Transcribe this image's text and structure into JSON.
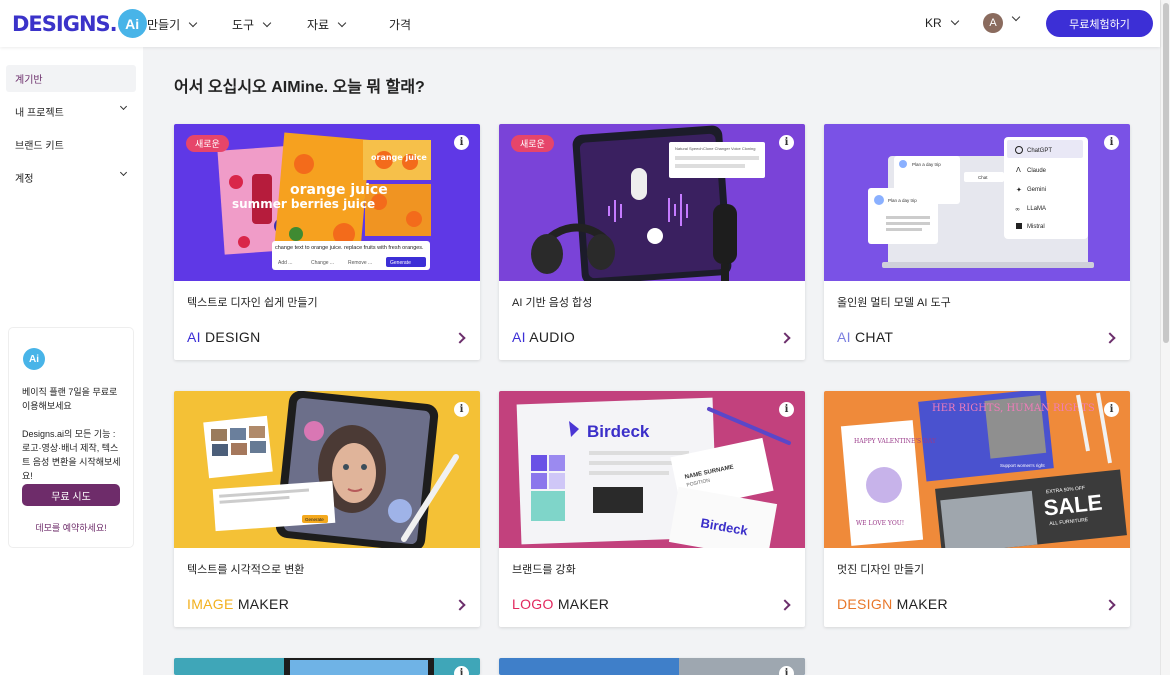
{
  "header": {
    "logo_text": "DESIGNS.",
    "logo_badge": "Ai",
    "nav": [
      {
        "label": "만들기"
      },
      {
        "label": "도구"
      },
      {
        "label": "자료"
      },
      {
        "label": "가격"
      }
    ],
    "language": "KR",
    "avatar_initial": "A",
    "cta_label": "무료체험하기"
  },
  "sidebar": {
    "items": [
      {
        "label": "계기반"
      },
      {
        "label": "내 프로젝트"
      },
      {
        "label": "브랜드 키트"
      },
      {
        "label": "계정"
      }
    ],
    "promo": {
      "badge": "Ai",
      "title": "베이직 플랜 7일을 무료로 이용해보세요",
      "body": "Designs.ai의 모든 기능 : 로고·영상·배너 제작, 텍스트 음성 변환을 시작해보세요!",
      "button": "무료 시도",
      "link": "데모를 예약하세요!"
    }
  },
  "main": {
    "greeting": "어서 오십시오 AIMine. 오늘 뭐 할래?",
    "new_badge": "새로운",
    "info_icon": "i",
    "cards": [
      {
        "desc": "텍스트로 디자인 쉽게 만들기",
        "brand_prefix": "AI",
        "brand_rest": " DESIGN",
        "prefix_color": "#3c2fd6",
        "badge": true,
        "thumb": {
          "word1": "summer berries juice",
          "word2": "orange juice",
          "word3": "orange juice",
          "prompt": "change text to orange juice. replace fruits with fresh oranges.",
          "chip1": "Add ...",
          "chip2": "Change ...",
          "chip3": "Remove ...",
          "gen": "Generate"
        }
      },
      {
        "desc": "AI 기반 음성 합성",
        "brand_prefix": "AI",
        "brand_rest": " AUDIO",
        "prefix_color": "#3c2fd6",
        "badge": true,
        "thumb": {
          "t1": "Natural Speech",
          "t2": "Clone Changer",
          "t3": "Voice Cloning"
        }
      },
      {
        "desc": "올인원 멀티 모델 AI 도구",
        "brand_prefix": "AI",
        "brand_rest": " CHAT",
        "prefix_color": "#7b7fe0",
        "badge": false,
        "thumb": {
          "models": [
            "ChatGPT",
            "Claude",
            "Gemini",
            "LLaMA",
            "Mistral"
          ],
          "p1": "Plan a day trip",
          "p2": "Chat",
          "p3": "Plan a day trip"
        }
      },
      {
        "desc": "텍스트를 시각적으로 변환",
        "brand_prefix": "IMAGE",
        "brand_rest": " MAKER",
        "prefix_color": "#f2b01e",
        "badge": false,
        "thumb": {
          "gen": "Generate"
        }
      },
      {
        "desc": "브랜드를 강화",
        "brand_prefix": "LOGO",
        "brand_rest": " MAKER",
        "prefix_color": "#e2285e",
        "badge": false,
        "thumb": {
          "brand": "Birdeck",
          "card_name": "NAME SURNAME",
          "card_pos": "POSITION"
        }
      },
      {
        "desc": "멋진 디자인 만들기",
        "brand_prefix": "DESIGN",
        "brand_rest": " MAKER",
        "prefix_color": "#e8772a",
        "badge": false,
        "thumb": {
          "h1": "HER RIGHTS, HUMAN RIGHTS",
          "h2": "Support women's right",
          "v1": "HAPPY VALENTINE'S DAY",
          "v2": "WE LOVE YOU!",
          "s1": "EXTRA 50% OFF",
          "s2": "SALE",
          "s3": "ALL FURNITURE"
        }
      }
    ]
  }
}
